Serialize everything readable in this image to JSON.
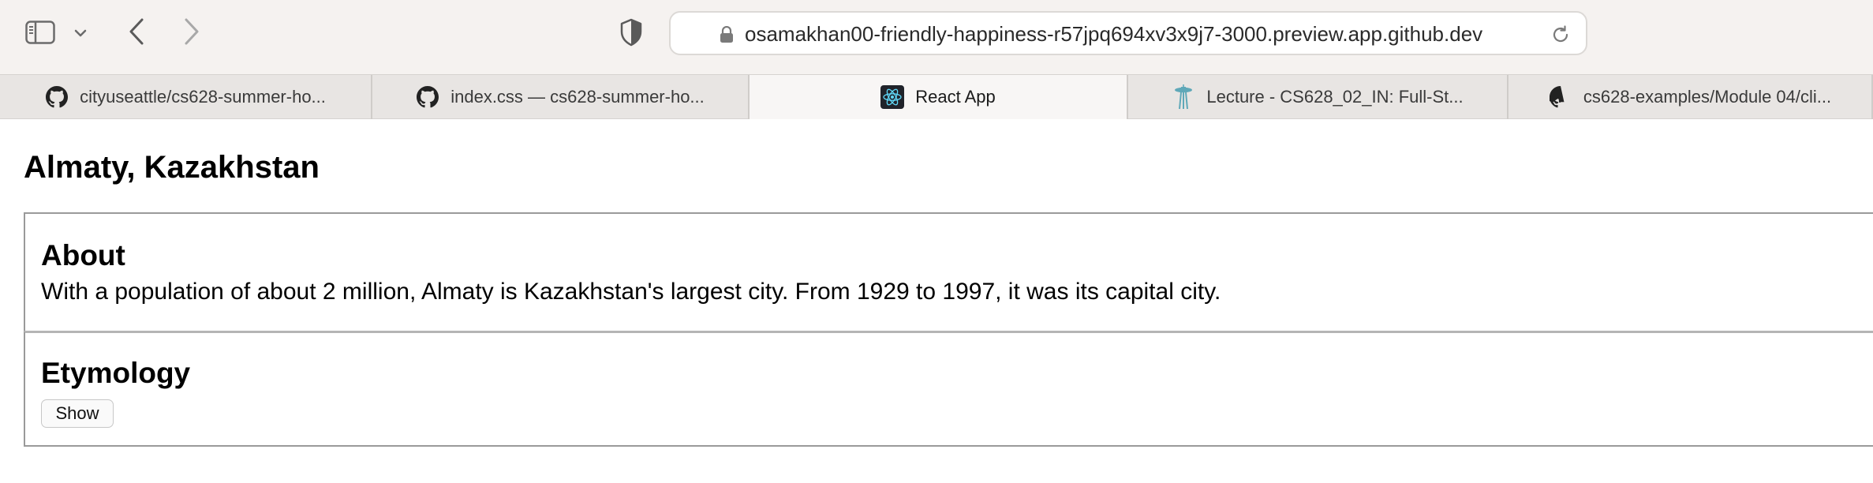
{
  "browser": {
    "url": "osamakhan00-friendly-happiness-r57jpq694xv3x9j7-3000.preview.app.github.dev",
    "icons": {
      "sidebar": "sidebar-icon",
      "sidebar_menu": "chevron-down-icon",
      "back": "chevron-left-icon",
      "forward": "chevron-right-icon",
      "privacy": "shield-icon",
      "lock": "lock-icon",
      "reload": "reload-icon"
    },
    "tabs": [
      {
        "label": "cityuseattle/cs628-summer-ho...",
        "icon": "github-icon",
        "active": false
      },
      {
        "label": "index.css — cs628-summer-ho...",
        "icon": "github-icon",
        "active": false
      },
      {
        "label": "React App",
        "icon": "react-icon",
        "active": true
      },
      {
        "label": "Lecture - CS628_02_IN: Full-St...",
        "icon": "space-needle-icon",
        "active": false
      },
      {
        "label": "cs628-examples/Module 04/cli...",
        "icon": "github-icon",
        "active": false
      }
    ]
  },
  "page": {
    "title": "Almaty, Kazakhstan",
    "about": {
      "heading": "About",
      "text": "With a population of about 2 million, Almaty is Kazakhstan's largest city. From 1929 to 1997, it was its capital city."
    },
    "etymology": {
      "heading": "Etymology",
      "button_label": "Show"
    }
  },
  "colors": {
    "toolbar_bg": "#f5f2f0",
    "tabstrip_bg": "#e8e5e3",
    "active_tab_bg": "#f8f6f5",
    "react_logo": "#61dafb",
    "space_needle": "#5fa8b8"
  }
}
